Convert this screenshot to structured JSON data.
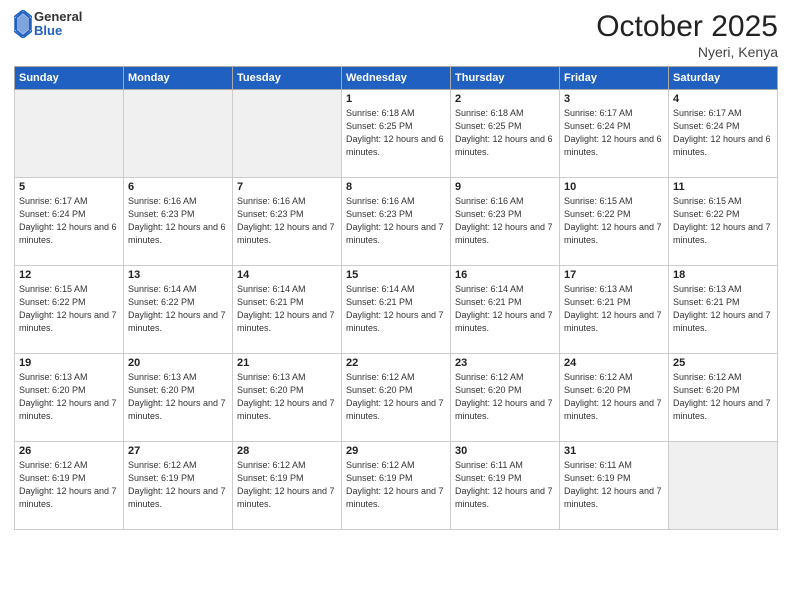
{
  "header": {
    "logo_general": "General",
    "logo_blue": "Blue",
    "month_title": "October 2025",
    "location": "Nyeri, Kenya"
  },
  "days_of_week": [
    "Sunday",
    "Monday",
    "Tuesday",
    "Wednesday",
    "Thursday",
    "Friday",
    "Saturday"
  ],
  "weeks": [
    [
      {
        "day": "",
        "empty": true
      },
      {
        "day": "",
        "empty": true
      },
      {
        "day": "",
        "empty": true
      },
      {
        "day": "1",
        "sunrise": "6:18 AM",
        "sunset": "6:25 PM",
        "daylight": "12 hours and 6 minutes."
      },
      {
        "day": "2",
        "sunrise": "6:18 AM",
        "sunset": "6:25 PM",
        "daylight": "12 hours and 6 minutes."
      },
      {
        "day": "3",
        "sunrise": "6:17 AM",
        "sunset": "6:24 PM",
        "daylight": "12 hours and 6 minutes."
      },
      {
        "day": "4",
        "sunrise": "6:17 AM",
        "sunset": "6:24 PM",
        "daylight": "12 hours and 6 minutes."
      }
    ],
    [
      {
        "day": "5",
        "sunrise": "6:17 AM",
        "sunset": "6:24 PM",
        "daylight": "12 hours and 6 minutes."
      },
      {
        "day": "6",
        "sunrise": "6:16 AM",
        "sunset": "6:23 PM",
        "daylight": "12 hours and 6 minutes."
      },
      {
        "day": "7",
        "sunrise": "6:16 AM",
        "sunset": "6:23 PM",
        "daylight": "12 hours and 7 minutes."
      },
      {
        "day": "8",
        "sunrise": "6:16 AM",
        "sunset": "6:23 PM",
        "daylight": "12 hours and 7 minutes."
      },
      {
        "day": "9",
        "sunrise": "6:16 AM",
        "sunset": "6:23 PM",
        "daylight": "12 hours and 7 minutes."
      },
      {
        "day": "10",
        "sunrise": "6:15 AM",
        "sunset": "6:22 PM",
        "daylight": "12 hours and 7 minutes."
      },
      {
        "day": "11",
        "sunrise": "6:15 AM",
        "sunset": "6:22 PM",
        "daylight": "12 hours and 7 minutes."
      }
    ],
    [
      {
        "day": "12",
        "sunrise": "6:15 AM",
        "sunset": "6:22 PM",
        "daylight": "12 hours and 7 minutes."
      },
      {
        "day": "13",
        "sunrise": "6:14 AM",
        "sunset": "6:22 PM",
        "daylight": "12 hours and 7 minutes."
      },
      {
        "day": "14",
        "sunrise": "6:14 AM",
        "sunset": "6:21 PM",
        "daylight": "12 hours and 7 minutes."
      },
      {
        "day": "15",
        "sunrise": "6:14 AM",
        "sunset": "6:21 PM",
        "daylight": "12 hours and 7 minutes."
      },
      {
        "day": "16",
        "sunrise": "6:14 AM",
        "sunset": "6:21 PM",
        "daylight": "12 hours and 7 minutes."
      },
      {
        "day": "17",
        "sunrise": "6:13 AM",
        "sunset": "6:21 PM",
        "daylight": "12 hours and 7 minutes."
      },
      {
        "day": "18",
        "sunrise": "6:13 AM",
        "sunset": "6:21 PM",
        "daylight": "12 hours and 7 minutes."
      }
    ],
    [
      {
        "day": "19",
        "sunrise": "6:13 AM",
        "sunset": "6:20 PM",
        "daylight": "12 hours and 7 minutes."
      },
      {
        "day": "20",
        "sunrise": "6:13 AM",
        "sunset": "6:20 PM",
        "daylight": "12 hours and 7 minutes."
      },
      {
        "day": "21",
        "sunrise": "6:13 AM",
        "sunset": "6:20 PM",
        "daylight": "12 hours and 7 minutes."
      },
      {
        "day": "22",
        "sunrise": "6:12 AM",
        "sunset": "6:20 PM",
        "daylight": "12 hours and 7 minutes."
      },
      {
        "day": "23",
        "sunrise": "6:12 AM",
        "sunset": "6:20 PM",
        "daylight": "12 hours and 7 minutes."
      },
      {
        "day": "24",
        "sunrise": "6:12 AM",
        "sunset": "6:20 PM",
        "daylight": "12 hours and 7 minutes."
      },
      {
        "day": "25",
        "sunrise": "6:12 AM",
        "sunset": "6:20 PM",
        "daylight": "12 hours and 7 minutes."
      }
    ],
    [
      {
        "day": "26",
        "sunrise": "6:12 AM",
        "sunset": "6:19 PM",
        "daylight": "12 hours and 7 minutes."
      },
      {
        "day": "27",
        "sunrise": "6:12 AM",
        "sunset": "6:19 PM",
        "daylight": "12 hours and 7 minutes."
      },
      {
        "day": "28",
        "sunrise": "6:12 AM",
        "sunset": "6:19 PM",
        "daylight": "12 hours and 7 minutes."
      },
      {
        "day": "29",
        "sunrise": "6:12 AM",
        "sunset": "6:19 PM",
        "daylight": "12 hours and 7 minutes."
      },
      {
        "day": "30",
        "sunrise": "6:11 AM",
        "sunset": "6:19 PM",
        "daylight": "12 hours and 7 minutes."
      },
      {
        "day": "31",
        "sunrise": "6:11 AM",
        "sunset": "6:19 PM",
        "daylight": "12 hours and 7 minutes."
      },
      {
        "day": "",
        "empty": true
      }
    ]
  ]
}
